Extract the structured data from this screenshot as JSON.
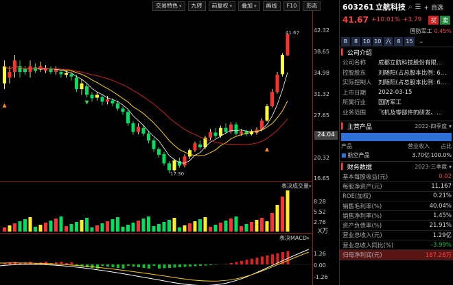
{
  "toolbar": {
    "items": [
      "交易特色",
      "九转",
      "前复权",
      "叠加",
      "画线",
      "F10",
      "形态"
    ]
  },
  "chart": {
    "price_scale": [
      "42.32",
      "38.65",
      "34.98",
      "31.32",
      "27.65",
      "24.04",
      "20.32",
      "16.65"
    ],
    "current_price_tag": "24.04",
    "high_label": "41.67",
    "low_label": "17.30",
    "volume_label": "表决成交量",
    "volume_scale": [
      "8.28",
      "5.52",
      "2.76"
    ],
    "volume_unit": "X万",
    "macd_label": "表决MACD",
    "macd_scale": [
      "1.26",
      "0.00",
      "-1.26"
    ],
    "up_color": "#ff3030",
    "down_color": "#00e060",
    "ma_colors": [
      "#ffffff",
      "#ffd000",
      "#c81e1e"
    ]
  },
  "stock": {
    "code": "603261",
    "name": "立航科技",
    "price": "41.67",
    "change_pct": "+10.01%",
    "change_amt": "+3.79",
    "buy_label": "买",
    "sell_label": "卖",
    "add_fav": "+ 自选",
    "sector": "国防军工",
    "sector_chg": "0.45%",
    "tabs": [
      "B",
      "8",
      "10",
      "10",
      "六",
      "8",
      "15"
    ]
  },
  "company": {
    "title": "公司介绍",
    "rows": [
      {
        "k": "公司名称",
        "v": "成都立航科技股份有限..."
      },
      {
        "k": "控股股东",
        "v": "刘随阳(占总股本比例: 6..."
      },
      {
        "k": "实际控制人",
        "v": "刘随阳(占总股本比例: 6..."
      },
      {
        "k": "上市日期",
        "v": "2022-03-15"
      },
      {
        "k": "所属行业",
        "v": "国防军工"
      },
      {
        "k": "业务范围",
        "v": "飞机及零部件的研发、..."
      }
    ]
  },
  "product": {
    "title": "主营产品",
    "period": "2022-四季度",
    "headers": [
      "产品",
      "营业收入",
      "占比"
    ],
    "row": {
      "name": "航空产品",
      "revenue": "3.70亿",
      "share": "100.0%"
    }
  },
  "finance": {
    "title": "财务数据",
    "period": "2023-三季度",
    "rows": [
      {
        "k": "基本每股收益(元)",
        "v": "0.02",
        "cls": "red"
      },
      {
        "k": "每股净资产(元)",
        "v": "11.167",
        "cls": ""
      },
      {
        "k": "ROE(加权)",
        "v": "0.21%",
        "cls": ""
      },
      {
        "k": "销售毛利率(%)",
        "v": "40.04%",
        "cls": ""
      },
      {
        "k": "销售净利率(%)",
        "v": "1.45%",
        "cls": ""
      },
      {
        "k": "资产负债率(%)",
        "v": "21.91%",
        "cls": ""
      },
      {
        "k": "营业总收入(元)",
        "v": "1.29亿",
        "cls": ""
      },
      {
        "k": "营业总收入同比(%)",
        "v": "-3.99%",
        "cls": "green"
      },
      {
        "k": "归母净利润(元)",
        "v": "187.28万",
        "cls": "red"
      }
    ]
  }
}
